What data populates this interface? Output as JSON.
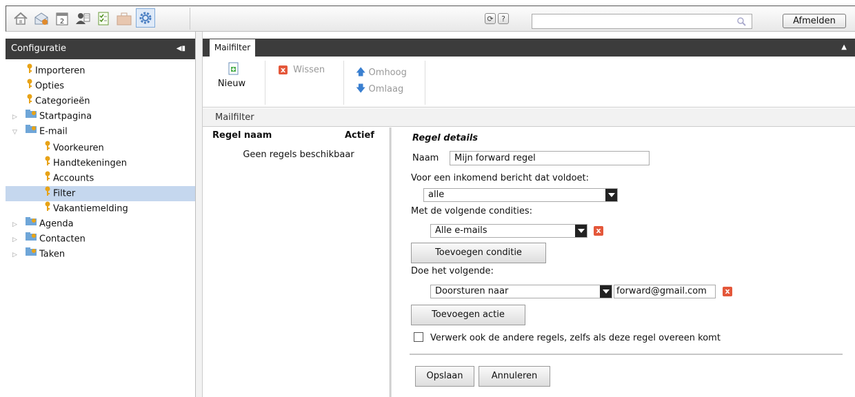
{
  "topbar": {
    "apps": [
      "home-icon",
      "mail-icon",
      "calendar-icon",
      "contacts-icon",
      "tasks-icon",
      "briefcase-icon",
      "settings-icon"
    ],
    "calendar_day": "2",
    "search_placeholder": "",
    "logout_label": "Afmelden"
  },
  "sidebar": {
    "title": "Configuratie",
    "items": [
      {
        "label": "Importeren"
      },
      {
        "label": "Opties"
      },
      {
        "label": "Categorieën"
      },
      {
        "label": "Startpagina"
      },
      {
        "label": "E-mail"
      },
      {
        "label": "Voorkeuren"
      },
      {
        "label": "Handtekeningen"
      },
      {
        "label": "Accounts"
      },
      {
        "label": "Filter"
      },
      {
        "label": "Vakantiemelding"
      },
      {
        "label": "Agenda"
      },
      {
        "label": "Contacten"
      },
      {
        "label": "Taken"
      }
    ]
  },
  "tab": {
    "label": "Mailfilter"
  },
  "ribbon": {
    "new_label": "Nieuw",
    "delete_label": "Wissen",
    "up_label": "Omhoog",
    "down_label": "Omlaag"
  },
  "subheader": {
    "title": "Mailfilter"
  },
  "list": {
    "col_name": "Regel naam",
    "col_active": "Actief",
    "empty_text": "Geen regels beschikbaar"
  },
  "details": {
    "heading": "Regel details",
    "name_label": "Naam",
    "name_value": "Mijn forward regel",
    "match_label": "Voor een inkomend bericht dat voldoet:",
    "match_value": "alle",
    "conditions_label": "Met de volgende condities:",
    "condition_value": "Alle e-mails",
    "add_condition": "Toevoegen conditie",
    "actions_label": "Doe het volgende:",
    "action_value": "Doorsturen naar",
    "action_target": "forward@gmail.com",
    "add_action": "Toevoegen actie",
    "continue_label": "Verwerk ook de andere regels, zelfs als deze regel overeen komt",
    "save": "Opslaan",
    "cancel": "Annuleren"
  }
}
